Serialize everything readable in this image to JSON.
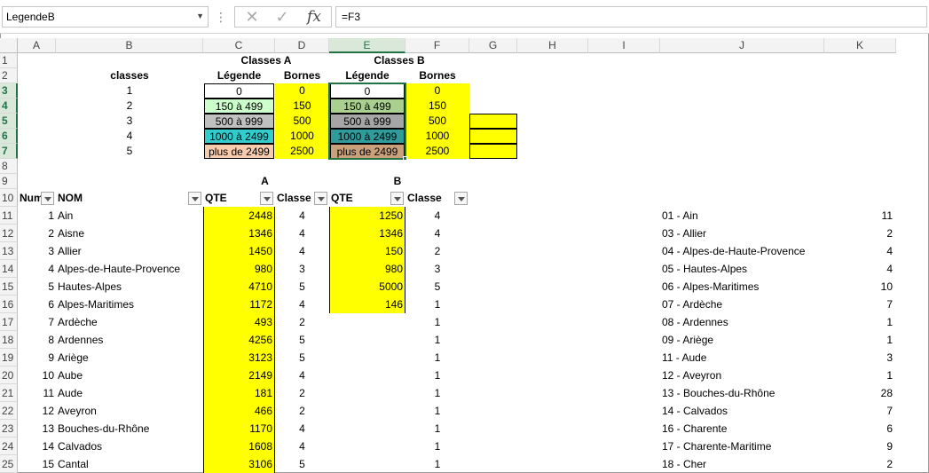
{
  "namebox": {
    "value": "LegendeB"
  },
  "formula": {
    "value": "=F3"
  },
  "columns": [
    "A",
    "B",
    "C",
    "D",
    "E",
    "F",
    "G",
    "H",
    "I",
    "J",
    "K"
  ],
  "rows": [
    "1",
    "2",
    "3",
    "4",
    "5",
    "6",
    "7",
    "8",
    "9",
    "10",
    "11",
    "12",
    "13",
    "14",
    "15",
    "16",
    "17",
    "18",
    "19",
    "20",
    "21",
    "22",
    "23",
    "24",
    "25"
  ],
  "legend": {
    "classesA": "Classes A",
    "classesB": "Classes B",
    "classes": "classes",
    "legendeA": "Légende",
    "bornesA": "Bornes",
    "legendeB": "Légende",
    "bornesB": "Bornes",
    "items": [
      {
        "cls": "1",
        "label": "0",
        "borne": "0"
      },
      {
        "cls": "2",
        "label": "150 à 499",
        "borne": "150"
      },
      {
        "cls": "3",
        "label": "500 à 999",
        "borne": "500"
      },
      {
        "cls": "4",
        "label": "1000 à 2499",
        "borne": "1000"
      },
      {
        "cls": "5",
        "label": "plus de 2499",
        "borne": "2500"
      }
    ]
  },
  "colors": {
    "A": [
      "#ffffff",
      "#ccffcc",
      "#c0c0c0",
      "#33cccc",
      "#f8cbad"
    ],
    "B": [
      "#ffffff",
      "#a9d08e",
      "#a6a6a6",
      "#2f9b9b",
      "#c9a07a"
    ]
  },
  "table": {
    "labelA": "A",
    "labelB": "B",
    "headers": [
      "Num",
      "NOM",
      "QTE",
      "Classe",
      "QTE",
      "Classe"
    ],
    "rows": [
      {
        "num": "1",
        "nom": "Ain",
        "qteA": "2448",
        "clsA": "4",
        "qteB": "1250",
        "clsB": "4"
      },
      {
        "num": "2",
        "nom": "Aisne",
        "qteA": "1346",
        "clsA": "4",
        "qteB": "1346",
        "clsB": "4"
      },
      {
        "num": "3",
        "nom": "Allier",
        "qteA": "1450",
        "clsA": "4",
        "qteB": "150",
        "clsB": "2"
      },
      {
        "num": "4",
        "nom": "Alpes-de-Haute-Provence",
        "qteA": "980",
        "clsA": "3",
        "qteB": "980",
        "clsB": "3"
      },
      {
        "num": "5",
        "nom": "Hautes-Alpes",
        "qteA": "4710",
        "clsA": "5",
        "qteB": "5000",
        "clsB": "5"
      },
      {
        "num": "6",
        "nom": "Alpes-Maritimes",
        "qteA": "1172",
        "clsA": "4",
        "qteB": "146",
        "clsB": "1"
      },
      {
        "num": "7",
        "nom": "Ardèche",
        "qteA": "493",
        "clsA": "2",
        "qteB": "",
        "clsB": "1"
      },
      {
        "num": "8",
        "nom": "Ardennes",
        "qteA": "4256",
        "clsA": "5",
        "qteB": "",
        "clsB": "1"
      },
      {
        "num": "9",
        "nom": "Ariège",
        "qteA": "3123",
        "clsA": "5",
        "qteB": "",
        "clsB": "1"
      },
      {
        "num": "10",
        "nom": "Aube",
        "qteA": "2149",
        "clsA": "4",
        "qteB": "",
        "clsB": "1"
      },
      {
        "num": "11",
        "nom": "Aude",
        "qteA": "181",
        "clsA": "2",
        "qteB": "",
        "clsB": "1"
      },
      {
        "num": "12",
        "nom": "Aveyron",
        "qteA": "466",
        "clsA": "2",
        "qteB": "",
        "clsB": "1"
      },
      {
        "num": "13",
        "nom": "Bouches-du-Rhône",
        "qteA": "1170",
        "clsA": "4",
        "qteB": "",
        "clsB": "1"
      },
      {
        "num": "14",
        "nom": "Calvados",
        "qteA": "1608",
        "clsA": "4",
        "qteB": "",
        "clsB": "1"
      },
      {
        "num": "15",
        "nom": "Cantal",
        "qteA": "3106",
        "clsA": "5",
        "qteB": "",
        "clsB": "1"
      }
    ]
  },
  "right_list": [
    {
      "name": "01 - Ain",
      "val": "11"
    },
    {
      "name": "03 - Allier",
      "val": "2"
    },
    {
      "name": "04 - Alpes-de-Haute-Provence",
      "val": "4"
    },
    {
      "name": "05 - Hautes-Alpes",
      "val": "4"
    },
    {
      "name": "06 - Alpes-Maritimes",
      "val": "10"
    },
    {
      "name": "07 - Ardèche",
      "val": "7"
    },
    {
      "name": "08 - Ardennes",
      "val": "1"
    },
    {
      "name": "09 - Ariège",
      "val": "1"
    },
    {
      "name": "11 - Aude",
      "val": "3"
    },
    {
      "name": "12 - Aveyron",
      "val": "1"
    },
    {
      "name": "13 - Bouches-du-Rhône",
      "val": "28"
    },
    {
      "name": "14 - Calvados",
      "val": "7"
    },
    {
      "name": "16 - Charente",
      "val": "6"
    },
    {
      "name": "17 - Charente-Maritime",
      "val": "9"
    },
    {
      "name": "18 - Cher",
      "val": "2"
    }
  ],
  "selected": {
    "column": "E",
    "rows": [
      "3",
      "4",
      "5",
      "6",
      "7"
    ]
  }
}
